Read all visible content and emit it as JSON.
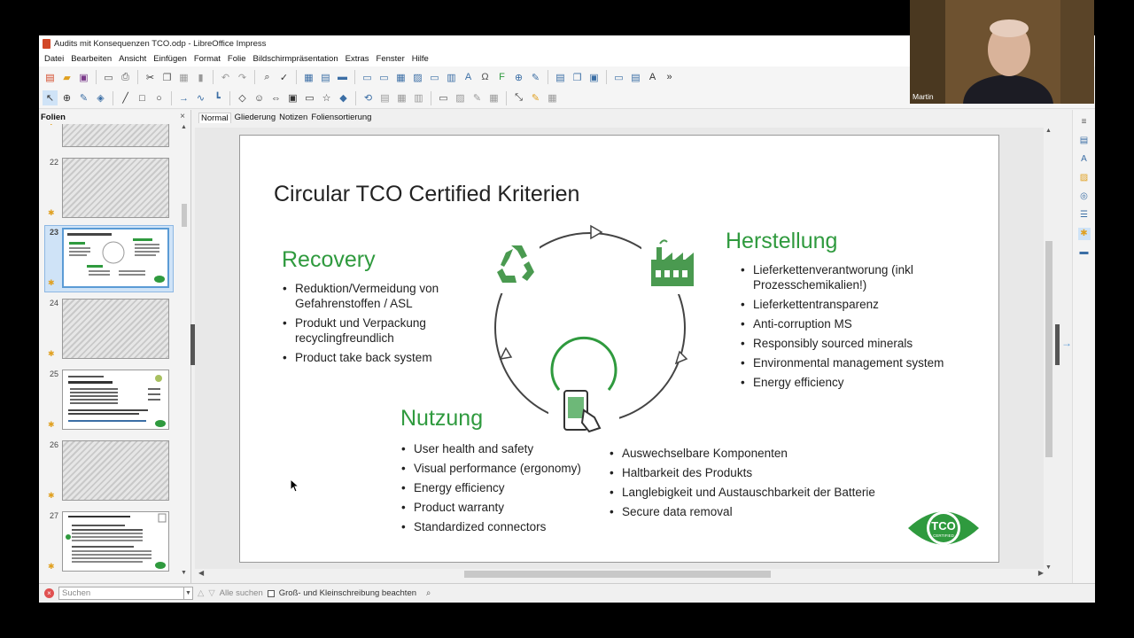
{
  "window": {
    "title": "Audits mit Konsequenzen TCO.odp - LibreOffice Impress"
  },
  "menu": [
    "Datei",
    "Bearbeiten",
    "Ansicht",
    "Einfügen",
    "Format",
    "Folie",
    "Bildschirmpräsentation",
    "Extras",
    "Fenster",
    "Hilfe"
  ],
  "sidebar": {
    "title": "Folien",
    "slides": [
      {
        "num": "",
        "type": "pattern"
      },
      {
        "num": "22",
        "type": "pattern"
      },
      {
        "num": "23",
        "type": "current"
      },
      {
        "num": "24",
        "type": "pattern"
      },
      {
        "num": "25",
        "type": "white"
      },
      {
        "num": "26",
        "type": "pattern"
      },
      {
        "num": "27",
        "type": "white"
      }
    ]
  },
  "view_tabs": [
    "Normal",
    "Gliederung",
    "Notizen",
    "Foliensortierung"
  ],
  "slide": {
    "title": "Circular TCO Certified Kriterien",
    "recovery": {
      "heading": "Recovery",
      "items": [
        "Reduktion/Vermeidung von Gefahrenstoffen / ASL",
        "Produkt und Verpackung recyclingfreundlich",
        "Product take back system"
      ]
    },
    "herstellung": {
      "heading": "Herstellung",
      "items": [
        "Lieferkettenverantworung (inkl Prozesschemikalien!)",
        "Lieferkettentransparenz",
        "Anti-corruption MS",
        "Responsibly sourced minerals",
        "Environmental management system",
        "Energy efficiency"
      ]
    },
    "nutzung": {
      "heading": "Nutzung",
      "items_left": [
        "User health and safety",
        "Visual performance (ergonomy)",
        "Energy efficiency",
        "Product warranty",
        "Standardized connectors"
      ],
      "items_right": [
        "Auswechselbare Komponenten",
        "Haltbarkeit des Produkts",
        "Langlebigkeit und Austauschbarkeit der Batterie",
        "Secure data removal"
      ]
    },
    "logo": {
      "text": "TCO",
      "sub": "CERTIFIED",
      "color": "#2f9a3e"
    }
  },
  "findbar": {
    "placeholder": "Suchen",
    "find_all": "Alle suchen",
    "match_case": "Groß- und Kleinschreibung beachten"
  },
  "webcam": {
    "name": "Martin"
  },
  "colors": {
    "green": "#2f9a3e",
    "accent": "#5b9bd5"
  }
}
